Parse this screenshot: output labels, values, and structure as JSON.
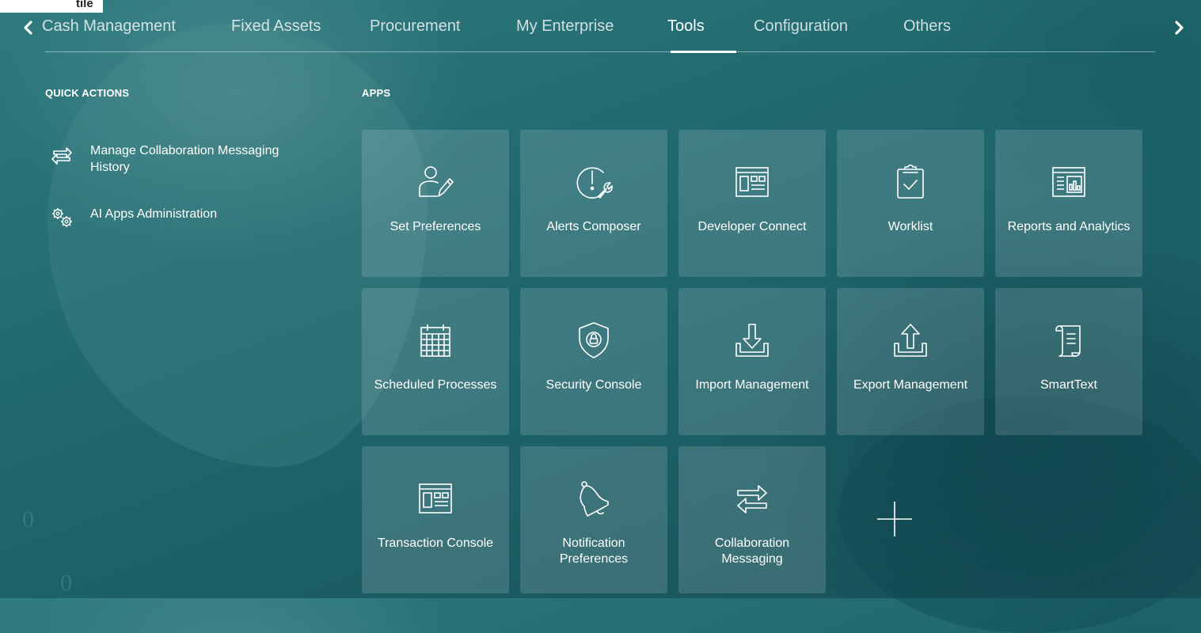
{
  "top_cut_text": "tile",
  "nav": {
    "tabs": [
      {
        "label": "Cash Management",
        "active": false
      },
      {
        "label": "Fixed Assets",
        "active": false
      },
      {
        "label": "Procurement",
        "active": false
      },
      {
        "label": "My Enterprise",
        "active": false
      },
      {
        "label": "Tools",
        "active": true
      },
      {
        "label": "Configuration",
        "active": false
      },
      {
        "label": "Others",
        "active": false
      }
    ],
    "prev_icon": "chevron-left-icon",
    "next_icon": "chevron-right-icon"
  },
  "quick_actions": {
    "title": "QUICK ACTIONS",
    "items": [
      {
        "label": "Manage Collaboration Messaging History",
        "icon": "swap-arrows-icon"
      },
      {
        "label": "AI Apps Administration",
        "icon": "gears-icon"
      }
    ]
  },
  "apps": {
    "title": "APPS",
    "tiles": [
      {
        "label": "Set Preferences",
        "icon": "user-pencil-icon"
      },
      {
        "label": "Alerts Composer",
        "icon": "alert-wrench-icon"
      },
      {
        "label": "Developer Connect",
        "icon": "window-panel-icon"
      },
      {
        "label": "Worklist",
        "icon": "clipboard-check-icon"
      },
      {
        "label": "Reports and Analytics",
        "icon": "report-chart-icon"
      },
      {
        "label": "Scheduled Processes",
        "icon": "calendar-icon"
      },
      {
        "label": "Security Console",
        "icon": "shield-lock-icon"
      },
      {
        "label": "Import Management",
        "icon": "import-tray-icon"
      },
      {
        "label": "Export Management",
        "icon": "export-tray-icon"
      },
      {
        "label": "SmartText",
        "icon": "scroll-text-icon"
      },
      {
        "label": "Transaction Console",
        "icon": "window-panel-icon"
      },
      {
        "label": "Notification Preferences",
        "icon": "bell-icon"
      },
      {
        "label": "Collaboration Messaging",
        "icon": "swap-arrows-icon"
      }
    ],
    "add_icon": "plus-icon"
  },
  "colors": {
    "background": "#216a70",
    "tile": "rgba(255,255,255,0.14)",
    "text": "#ffffff"
  }
}
